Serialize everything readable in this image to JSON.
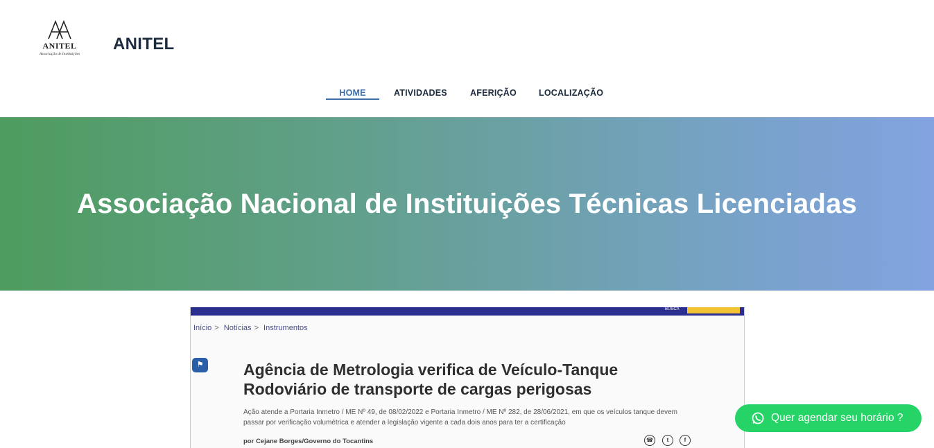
{
  "brand": {
    "logo_mark": "AA",
    "logo_word": "ANITEL",
    "logo_tagline": "Associação de Instituições",
    "site_title": "ANITEL"
  },
  "nav": {
    "items": [
      {
        "label": "HOME",
        "active": true
      },
      {
        "label": "ATIVIDADES",
        "active": false
      },
      {
        "label": "AFERIÇÃO",
        "active": false
      },
      {
        "label": "LOCALIZAÇÃO",
        "active": false
      }
    ]
  },
  "hero": {
    "title": "Associação Nacional de Instituições Técnicas Licenciadas",
    "gradient_start": "#4e9c5e",
    "gradient_end": "#82a3e0"
  },
  "article": {
    "topbar_label": "BUSCA",
    "breadcrumb": [
      "Início",
      "Notícias",
      "Instrumentos"
    ],
    "title": "Agência de Metrologia verifica de Veículo-Tanque Rodoviário de transporte de cargas perigosas",
    "lead": "Ação atende a Portaria Inmetro / ME Nº 49, de 08/02/2022 e Portaria Inmetro / ME Nº 282, de 28/06/2021, em que os veículos tanque devem passar por verificação volumétrica e atender a legislação vigente a cada dois anos para ter a certificação",
    "author": "por Cejane Borges/Governo do Tocantins",
    "share_icons": [
      "whatsapp-icon",
      "twitter-icon",
      "facebook-icon"
    ]
  },
  "cta": {
    "label": "Quer agendar seu horário ?",
    "color": "#25d366",
    "icon": "whatsapp-icon"
  }
}
